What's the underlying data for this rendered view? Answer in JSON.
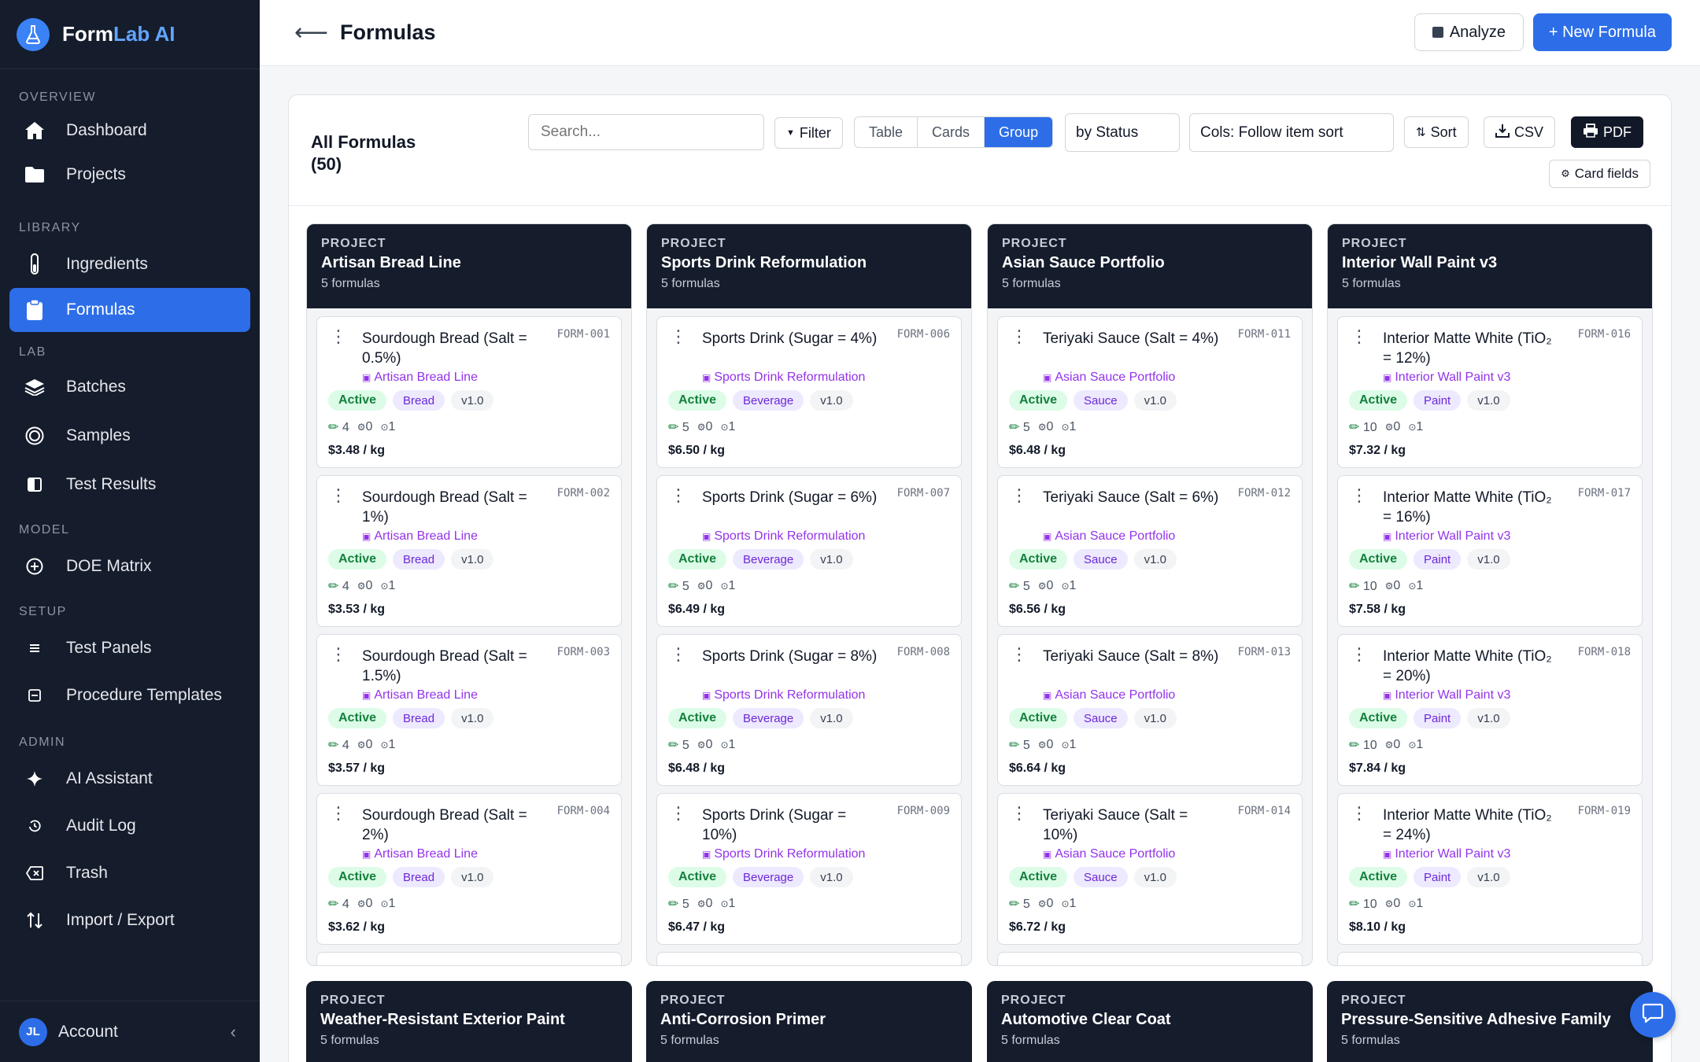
{
  "app": {
    "name_a": "Form",
    "name_b": "Lab AI"
  },
  "sidebar": {
    "sections": [
      "OVERVIEW",
      "LIBRARY",
      "LAB",
      "MODEL",
      "SETUP",
      "ADMIN"
    ],
    "items": [
      {
        "label": "Dashboard",
        "icon": "home-icon"
      },
      {
        "label": "Projects",
        "icon": "folder-icon"
      },
      {
        "label": "Ingredients",
        "icon": "test-tube-icon"
      },
      {
        "label": "Formulas",
        "icon": "clipboard-icon",
        "active": true
      },
      {
        "label": "Batches",
        "icon": "layers-icon"
      },
      {
        "label": "Samples",
        "icon": "target-icon"
      },
      {
        "label": "Test Results",
        "icon": "results-icon"
      },
      {
        "label": "DOE Matrix",
        "icon": "plus-circle-icon"
      },
      {
        "label": "Test Panels",
        "icon": "list-icon"
      },
      {
        "label": "Procedure Templates",
        "icon": "template-icon"
      },
      {
        "label": "AI Assistant",
        "icon": "sparkle-icon"
      },
      {
        "label": "Audit Log",
        "icon": "history-icon"
      },
      {
        "label": "Trash",
        "icon": "trash-icon"
      },
      {
        "label": "Import / Export",
        "icon": "import-export-icon"
      }
    ],
    "account": {
      "initials": "JL",
      "label": "Account",
      "collapse": "‹"
    }
  },
  "header": {
    "back": "⟵",
    "title": "Formulas",
    "analyze_label": "Analyze",
    "new_label": "+ New Formula"
  },
  "toolbar": {
    "title": "All Formulas",
    "count": "(50)",
    "search_placeholder": "Search...",
    "filter_label": "Filter",
    "views": [
      "Table",
      "Cards",
      "Group"
    ],
    "active_view": "Group",
    "group_by": "by Status",
    "cols": "Cols: Follow item sort",
    "sort_label": "Sort",
    "csv_label": "CSV",
    "pdf_label": "PDF",
    "card_fields_label": "Card fields"
  },
  "colors": {
    "accent": "#2d6ee8",
    "sidebar": "#151c2c",
    "project": "#9333ea",
    "status_bg": "#dcfce7",
    "status_fg": "#15803d"
  },
  "groups": [
    {
      "kicker": "PROJECT",
      "title": "Artisan Bread Line",
      "count": "5 formulas",
      "cards": [
        {
          "name": "Sourdough Bread (Salt = 0.5%)",
          "code": "FORM-001",
          "project": "Artisan Bread Line",
          "status": "Active",
          "category": "Bread",
          "version": "v1.0",
          "ingredients": "4",
          "a": "0",
          "b": "1",
          "price": "$3.48 / kg"
        },
        {
          "name": "Sourdough Bread (Salt = 1%)",
          "code": "FORM-002",
          "project": "Artisan Bread Line",
          "status": "Active",
          "category": "Bread",
          "version": "v1.0",
          "ingredients": "4",
          "a": "0",
          "b": "1",
          "price": "$3.53 / kg"
        },
        {
          "name": "Sourdough Bread (Salt = 1.5%)",
          "code": "FORM-003",
          "project": "Artisan Bread Line",
          "status": "Active",
          "category": "Bread",
          "version": "v1.0",
          "ingredients": "4",
          "a": "0",
          "b": "1",
          "price": "$3.57 / kg"
        },
        {
          "name": "Sourdough Bread (Salt = 2%)",
          "code": "FORM-004",
          "project": "Artisan Bread Line",
          "status": "Active",
          "category": "Bread",
          "version": "v1.0",
          "ingredients": "4",
          "a": "0",
          "b": "1",
          "price": "$3.62 / kg"
        }
      ]
    },
    {
      "kicker": "PROJECT",
      "title": "Sports Drink Reformulation",
      "count": "5 formulas",
      "cards": [
        {
          "name": "Sports Drink (Sugar = 4%)",
          "code": "FORM-006",
          "project": "Sports Drink Reformulation",
          "status": "Active",
          "category": "Beverage",
          "version": "v1.0",
          "ingredients": "5",
          "a": "0",
          "b": "1",
          "price": "$6.50 / kg"
        },
        {
          "name": "Sports Drink (Sugar = 6%)",
          "code": "FORM-007",
          "project": "Sports Drink Reformulation",
          "status": "Active",
          "category": "Beverage",
          "version": "v1.0",
          "ingredients": "5",
          "a": "0",
          "b": "1",
          "price": "$6.49 / kg"
        },
        {
          "name": "Sports Drink (Sugar = 8%)",
          "code": "FORM-008",
          "project": "Sports Drink Reformulation",
          "status": "Active",
          "category": "Beverage",
          "version": "v1.0",
          "ingredients": "5",
          "a": "0",
          "b": "1",
          "price": "$6.48 / kg"
        },
        {
          "name": "Sports Drink (Sugar = 10%)",
          "code": "FORM-009",
          "project": "Sports Drink Reformulation",
          "status": "Active",
          "category": "Beverage",
          "version": "v1.0",
          "ingredients": "5",
          "a": "0",
          "b": "1",
          "price": "$6.47 / kg"
        }
      ]
    },
    {
      "kicker": "PROJECT",
      "title": "Asian Sauce Portfolio",
      "count": "5 formulas",
      "cards": [
        {
          "name": "Teriyaki Sauce (Salt = 4%)",
          "code": "FORM-011",
          "project": "Asian Sauce Portfolio",
          "status": "Active",
          "category": "Sauce",
          "version": "v1.0",
          "ingredients": "5",
          "a": "0",
          "b": "1",
          "price": "$6.48 / kg"
        },
        {
          "name": "Teriyaki Sauce (Salt = 6%)",
          "code": "FORM-012",
          "project": "Asian Sauce Portfolio",
          "status": "Active",
          "category": "Sauce",
          "version": "v1.0",
          "ingredients": "5",
          "a": "0",
          "b": "1",
          "price": "$6.56 / kg"
        },
        {
          "name": "Teriyaki Sauce (Salt = 8%)",
          "code": "FORM-013",
          "project": "Asian Sauce Portfolio",
          "status": "Active",
          "category": "Sauce",
          "version": "v1.0",
          "ingredients": "5",
          "a": "0",
          "b": "1",
          "price": "$6.64 / kg"
        },
        {
          "name": "Teriyaki Sauce (Salt = 10%)",
          "code": "FORM-014",
          "project": "Asian Sauce Portfolio",
          "status": "Active",
          "category": "Sauce",
          "version": "v1.0",
          "ingredients": "5",
          "a": "0",
          "b": "1",
          "price": "$6.72 / kg"
        }
      ]
    },
    {
      "kicker": "PROJECT",
      "title": "Interior Wall Paint v3",
      "count": "5 formulas",
      "cards": [
        {
          "name": "Interior Matte White (TiO₂ = 12%)",
          "code": "FORM-016",
          "project": "Interior Wall Paint v3",
          "status": "Active",
          "category": "Paint",
          "version": "v1.0",
          "ingredients": "10",
          "a": "0",
          "b": "1",
          "price": "$7.32 / kg"
        },
        {
          "name": "Interior Matte White (TiO₂ = 16%)",
          "code": "FORM-017",
          "project": "Interior Wall Paint v3",
          "status": "Active",
          "category": "Paint",
          "version": "v1.0",
          "ingredients": "10",
          "a": "0",
          "b": "1",
          "price": "$7.58 / kg"
        },
        {
          "name": "Interior Matte White (TiO₂ = 20%)",
          "code": "FORM-018",
          "project": "Interior Wall Paint v3",
          "status": "Active",
          "category": "Paint",
          "version": "v1.0",
          "ingredients": "10",
          "a": "0",
          "b": "1",
          "price": "$7.84 / kg"
        },
        {
          "name": "Interior Matte White (TiO₂ = 24%)",
          "code": "FORM-019",
          "project": "Interior Wall Paint v3",
          "status": "Active",
          "category": "Paint",
          "version": "v1.0",
          "ingredients": "10",
          "a": "0",
          "b": "1",
          "price": "$8.10 / kg"
        }
      ]
    }
  ],
  "groups_below": [
    {
      "kicker": "PROJECT",
      "title": "Weather-Resistant Exterior Paint",
      "count": "5 formulas"
    },
    {
      "kicker": "PROJECT",
      "title": "Anti-Corrosion Primer",
      "count": "5 formulas"
    },
    {
      "kicker": "PROJECT",
      "title": "Automotive Clear Coat",
      "count": "5 formulas"
    },
    {
      "kicker": "PROJECT",
      "title": "Pressure-Sensitive Adhesive Family",
      "count": "5 formulas"
    }
  ]
}
